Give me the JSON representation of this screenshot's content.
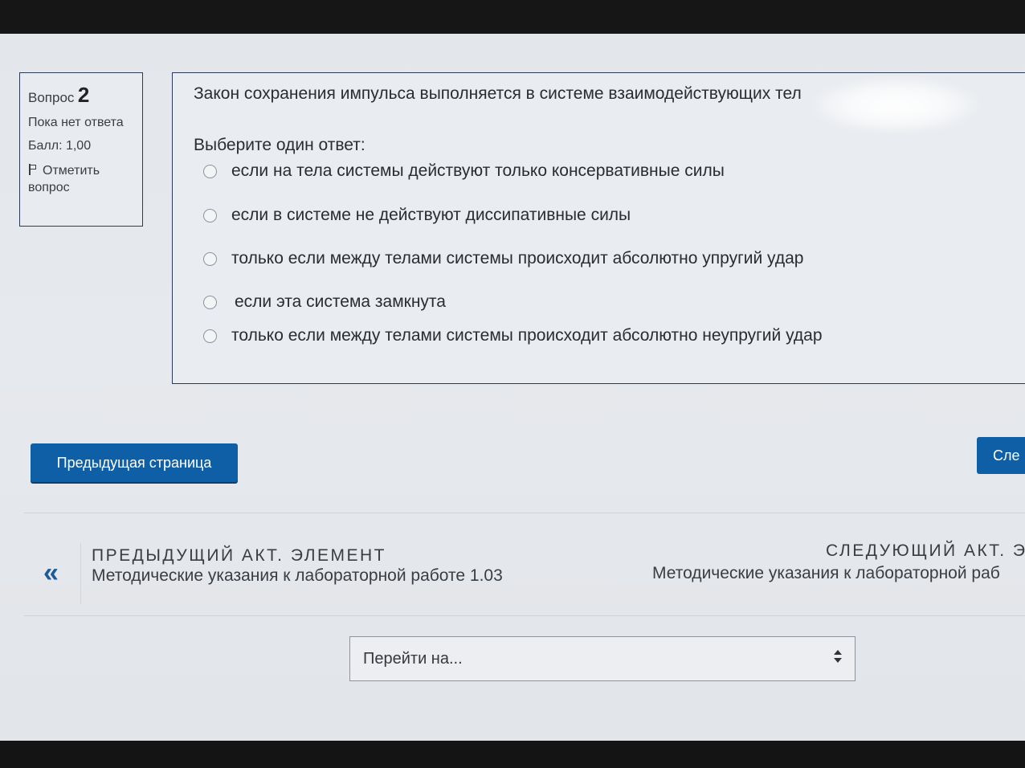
{
  "info": {
    "question_label": "Вопрос",
    "question_number": "2",
    "status": "Пока нет ответа",
    "grade": "Балл: 1,00",
    "flag": "Отметить вопрос"
  },
  "question": {
    "text": "Закон сохранения импульса выполняется в системе взаимодействующих тел",
    "prompt": "Выберите один ответ:",
    "options": [
      "если на тела системы действуют только консервативные силы",
      "если в системе не действуют диссипативные силы",
      "только если между телами системы происходит абсолютно упругий удар",
      "если эта система замкнута",
      "только если между телами системы происходит абсолютно неупругий удар"
    ]
  },
  "buttons": {
    "prev": "Предыдущая страница",
    "next": "Сле"
  },
  "activity_nav": {
    "prev_heading": "ПРЕДЫДУЩИЙ АКТ. ЭЛЕМЕНТ",
    "prev_title": "Методические указания к лабораторной работе 1.03",
    "next_heading": "СЛЕДУЮЩИЙ АКТ. Э",
    "next_title": "Методические указания к лабораторной раб",
    "arrow": "«"
  },
  "jump": {
    "label": "Перейти на..."
  },
  "colors": {
    "accent": "#0f5fa6",
    "border": "#2b3a57"
  }
}
